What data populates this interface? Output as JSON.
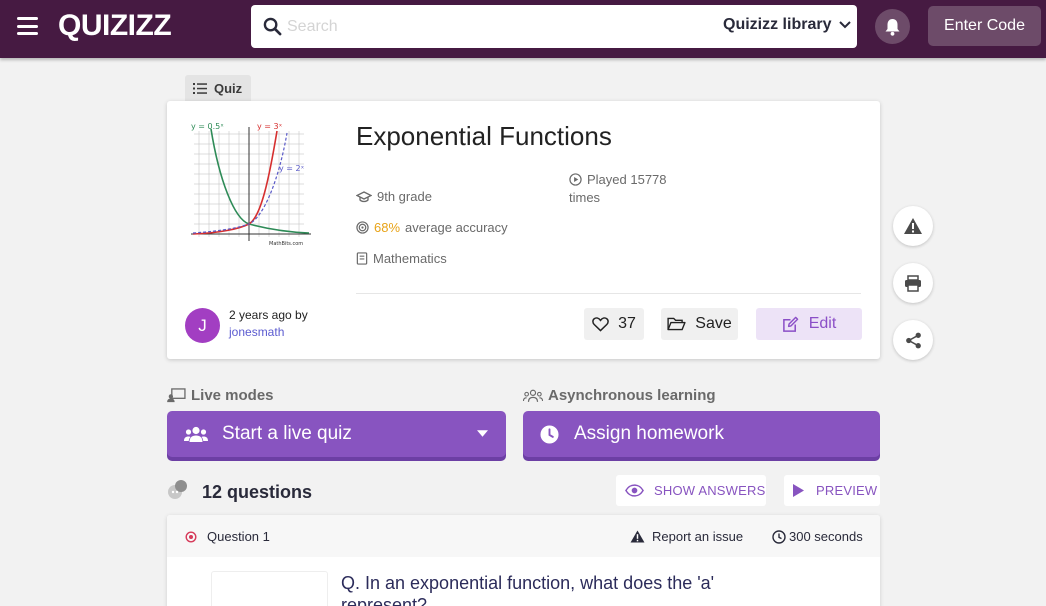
{
  "header": {
    "logo": "QUIZIZZ",
    "search_placeholder": "Search",
    "library_label": "Quizizz library",
    "enter_code_label": "Enter Code"
  },
  "quiz": {
    "tag": "Quiz",
    "title": "Exponential Functions",
    "grade": "9th grade",
    "accuracy_value": "68%",
    "accuracy_label": "average accuracy",
    "subject": "Mathematics",
    "played_line1": "Played 15778",
    "played_line2": "times",
    "thumbnail": {
      "labels": [
        "y = 0.5ˣ",
        "y = 3ˣ",
        "y = 2ˣ",
        "MathBits.com"
      ]
    }
  },
  "author": {
    "initial": "J",
    "time": "2 years ago by",
    "name": "jonesmath"
  },
  "actions": {
    "likes": "37",
    "save_label": "Save",
    "edit_label": "Edit"
  },
  "modes": {
    "live_label": "Live modes",
    "live_button": "Start a live quiz",
    "async_label": "Asynchronous learning",
    "async_button": "Assign homework"
  },
  "questions": {
    "count_label": "12 questions",
    "show_answers": "SHOW ANSWERS",
    "preview": "PREVIEW",
    "items": [
      {
        "number": "Question 1",
        "report": "Report an issue",
        "time": "300 seconds",
        "text": "Q. In an exponential function, what does the 'a' represent?"
      }
    ]
  },
  "colors": {
    "brand": "#461a42",
    "accent": "#8854c0",
    "accuracy": "#e8a317"
  }
}
